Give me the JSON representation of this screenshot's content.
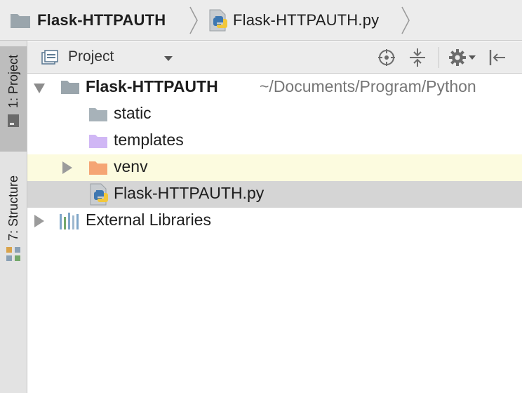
{
  "breadcrumb": {
    "project": "Flask-HTTPAUTH",
    "file": "Flask-HTTPAUTH.py",
    "project_icon": "folder-icon",
    "file_icon": "python-file-icon"
  },
  "left_strip": {
    "tabs": [
      {
        "label": "1: Project",
        "icon": "project-icon",
        "active": true
      },
      {
        "label": "7: Structure",
        "icon": "structure-icon",
        "active": false
      }
    ]
  },
  "panel": {
    "title": "Project",
    "title_icon": "project-view-icon",
    "toolbar": [
      {
        "name": "scroll-from-source-icon"
      },
      {
        "name": "collapse-all-icon"
      },
      {
        "name": "gear-icon"
      },
      {
        "name": "hide-panel-icon"
      }
    ]
  },
  "tree": {
    "root": {
      "name": "Flask-HTTPAUTH",
      "path": "~/Documents/Program/Python"
    },
    "children": [
      {
        "name": "static",
        "icon": "folder-icon"
      },
      {
        "name": "templates",
        "icon": "templates-folder-icon"
      },
      {
        "name": "venv",
        "icon": "excluded-folder-icon"
      },
      {
        "name": "Flask-HTTPAUTH.py",
        "icon": "python-file-icon"
      }
    ],
    "external": {
      "name": "External Libraries",
      "icon": "libraries-icon"
    }
  },
  "colors": {
    "folder": "#a7b2b9",
    "templates_folder": "#d0b7f5",
    "venv_folder": "#f5a574",
    "selected_row": "#d5d5d5",
    "highlight_row": "#fcfbdf"
  }
}
